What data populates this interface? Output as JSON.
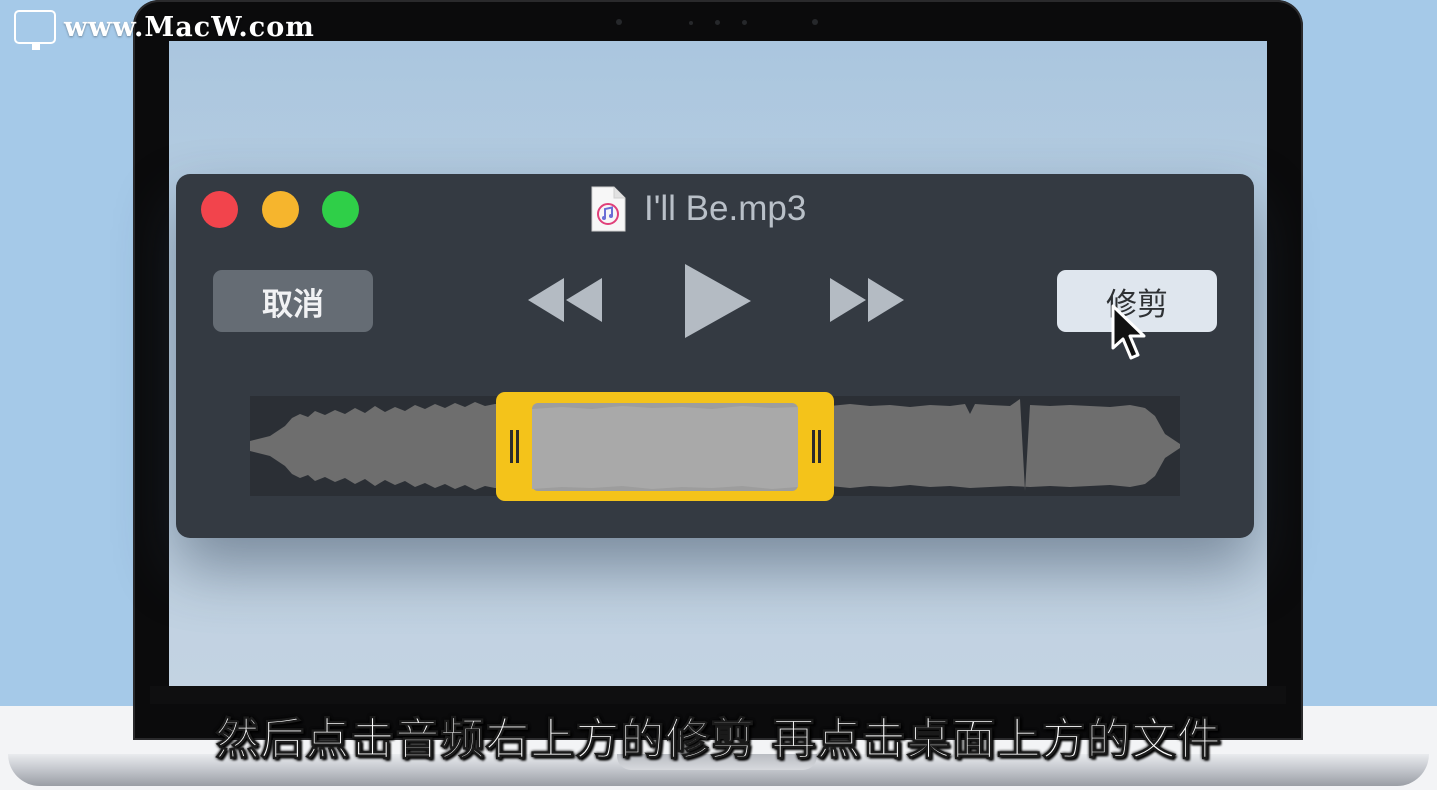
{
  "watermark": {
    "text": "www.MacW.com"
  },
  "window": {
    "title": "I'll Be.mp3",
    "file_icon": "music-file-icon",
    "traffic_lights": {
      "close_color": "#f2444c",
      "minimize_color": "#f6b52d",
      "maximize_color": "#2fcf48"
    },
    "buttons": {
      "cancel_label": "取消",
      "trim_label": "修剪"
    },
    "controls": {
      "rewind_icon": "rewind-icon",
      "play_icon": "play-icon",
      "fast_forward_icon": "fast-forward-icon"
    },
    "trim_selection": {
      "start_fraction": 0.265,
      "end_fraction": 0.628,
      "frame_color": "#f4c31a"
    }
  },
  "subtitle": {
    "text": "然后点击音频右上方的修剪 再点击桌面上方的文件"
  }
}
